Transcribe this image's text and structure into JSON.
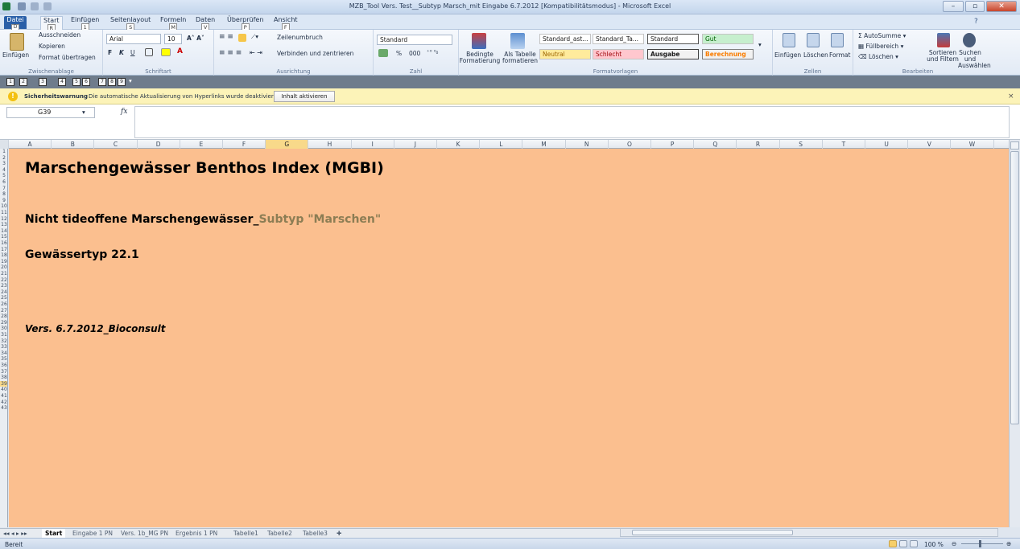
{
  "window": {
    "title": "MZB_Tool Vers. Test__Subtyp Marsch_mit Eingabe 6.7.2012 [Kompatibilitätsmodus] - Microsoft Excel",
    "minimize": "–",
    "restore": "▫",
    "close": "✕"
  },
  "ribbon_tabs": [
    {
      "label": "Datei",
      "key": "D"
    },
    {
      "label": "Start",
      "key": "R"
    },
    {
      "label": "Einfügen",
      "key": "1"
    },
    {
      "label": "Seitenlayout",
      "key": "S"
    },
    {
      "label": "Formeln",
      "key": "M"
    },
    {
      "label": "Daten",
      "key": "V"
    },
    {
      "label": "Überprüfen",
      "key": "P"
    },
    {
      "label": "Ansicht",
      "key": "F"
    }
  ],
  "clipboard": {
    "paste": "Einfügen",
    "cut": "Ausschneiden",
    "copy": "Kopieren",
    "format_painter": "Format übertragen",
    "group": "Zwischenablage"
  },
  "font": {
    "name": "Arial",
    "size": "10",
    "bold": "F",
    "italic": "K",
    "underline": "U",
    "group": "Schriftart"
  },
  "alignment": {
    "wrap": "Zeilenumbruch",
    "merge": "Verbinden und zentrieren",
    "group": "Ausrichtung"
  },
  "number": {
    "format": "Standard",
    "percent": "%",
    "thousands": "000",
    "group": "Zahl"
  },
  "styles": {
    "conditional": "Bedingte Formatierung",
    "as_table": "Als Tabelle formatieren",
    "cells": [
      "Standard_ast...",
      "Standard_Ta...",
      "Standard",
      "Gut",
      "Neutral",
      "Schlecht",
      "Ausgabe",
      "Berechnung"
    ],
    "group": "Formatvorlagen"
  },
  "cells_group": {
    "insert": "Einfügen",
    "delete": "Löschen",
    "format": "Format",
    "group": "Zellen"
  },
  "editing": {
    "autosum": "AutoSumme",
    "fill": "Füllbereich",
    "clear": "Löschen",
    "sort": "Sortieren und Filtern",
    "find": "Suchen und Auswählen",
    "group": "Bearbeiten"
  },
  "quickkeys": [
    "1",
    "2",
    "3",
    "4",
    "5",
    "6",
    "7",
    "8",
    "9"
  ],
  "security": {
    "title": "Sicherheitswarnung",
    "message": "Die automatische Aktualisierung von Hyperlinks wurde deaktiviert.",
    "button": "Inhalt aktivieren",
    "close": "×"
  },
  "formula_bar": {
    "cell_ref": "G39",
    "fx": "fx",
    "value": ""
  },
  "columns": [
    "A",
    "B",
    "C",
    "D",
    "E",
    "F",
    "G",
    "H",
    "I",
    "J",
    "K",
    "L",
    "M",
    "N",
    "O",
    "P",
    "Q",
    "R",
    "S",
    "T",
    "U",
    "V",
    "W"
  ],
  "selected_column": "G",
  "rows": [
    "1",
    "2",
    "3",
    "4",
    "5",
    "6",
    "7",
    "8",
    "9",
    "10",
    "11",
    "12",
    "13",
    "14",
    "15",
    "16",
    "17",
    "18",
    "19",
    "20",
    "21",
    "22",
    "23",
    "24",
    "25",
    "26",
    "27",
    "28",
    "29",
    "30",
    "31",
    "32",
    "33",
    "34",
    "35",
    "36",
    "37",
    "38",
    "39",
    "40",
    "41",
    "42",
    "43"
  ],
  "selected_row": "39",
  "content": {
    "title": "Marschengewässer Benthos Index  (MGBI)",
    "subtitle_a": "Nicht tideoffene Marschengewässer_",
    "subtitle_b": "Subtyp \"Marschen\"",
    "gewaessertyp": "Gewässertyp 22.1",
    "version": "Vers. 6.7.2012_Bioconsult"
  },
  "sheet_tabs": [
    "Start",
    "Eingabe 1 PN",
    "Vers. 1b_MG PN",
    "Ergebnis 1 PN",
    "Tabelle1",
    "Tabelle2",
    "Tabelle3"
  ],
  "active_sheet": "Start",
  "status": {
    "mode": "Bereit",
    "zoom": "100 %"
  },
  "colors": {
    "sheet_bg": "#fbbf8f",
    "subtype_text": "#8c7d54",
    "selection": "#f8d98a"
  }
}
